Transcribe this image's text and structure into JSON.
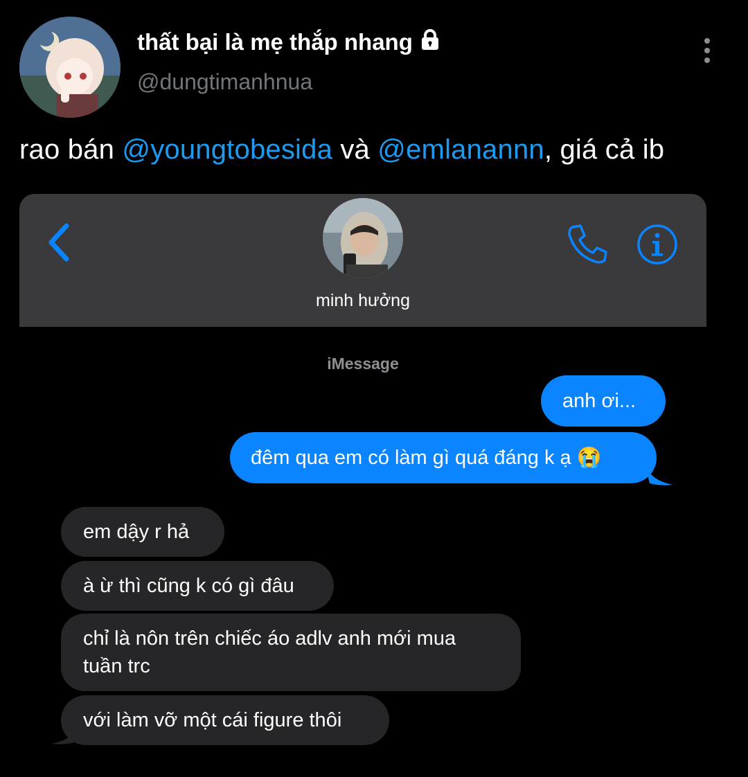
{
  "tweet": {
    "display_name": "thất bại là mẹ thắp nhang",
    "handle": "@dungtimanhnua",
    "text": {
      "part1": "rao bán ",
      "mention1": "@youngtobesida",
      "part2": " và ",
      "mention2": "@emlanannn",
      "part3": ", giá cả ib"
    }
  },
  "imessage": {
    "contact_name": "minh hưởng",
    "service_label": "iMessage",
    "messages": [
      {
        "direction": "sent",
        "text": "anh ơi..."
      },
      {
        "direction": "sent",
        "text": "đêm qua em có làm gì quá đáng k ạ 😭"
      },
      {
        "direction": "received",
        "text": "em dậy r hả"
      },
      {
        "direction": "received",
        "text": "à ừ thì cũng k có gì đâu"
      },
      {
        "direction": "received",
        "line1": "chỉ là nôn trên chiếc áo adlv anh mới mua",
        "line2": "tuần trc"
      },
      {
        "direction": "received",
        "text": "với làm vỡ một cái figure thôi"
      }
    ]
  },
  "colors": {
    "background": "#000000",
    "mention": "#1d9bf0",
    "handle": "#71767b",
    "ios_blue": "#0a84ff",
    "received_bubble": "#262628",
    "header_bg": "#3a3a3c"
  },
  "icons": [
    "lock-icon",
    "more-icon",
    "back-chevron-icon",
    "phone-icon",
    "info-icon"
  ]
}
